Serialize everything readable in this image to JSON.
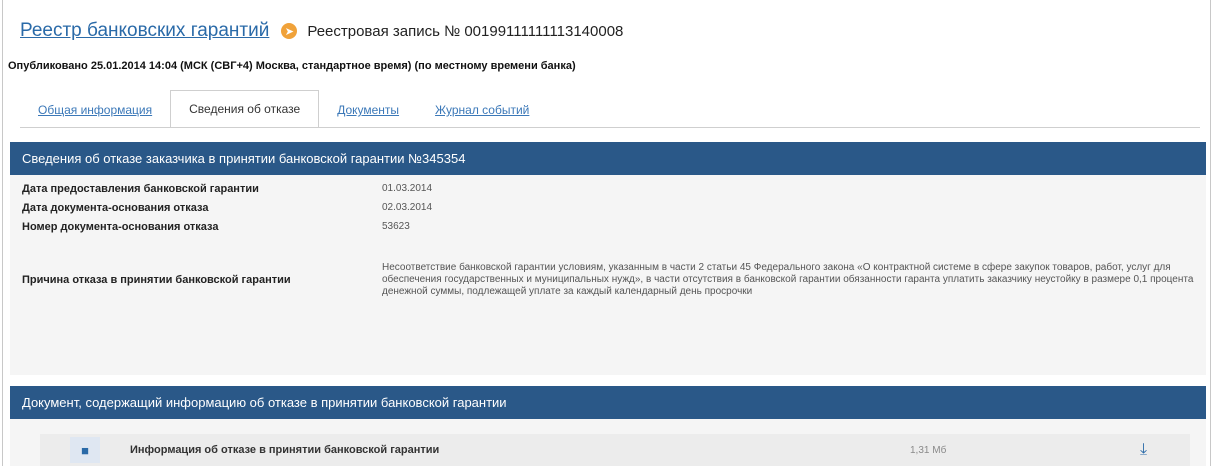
{
  "breadcrumb": {
    "root_label": "Реестр банковских гарантий",
    "current_label": "Реестровая запись № 00199111111113140008"
  },
  "published_text": "Опубликовано 25.01.2014 14:04 (МСК (СВГ+4) Москва, стандартное время) (по местному времени банка)",
  "tabs": [
    {
      "label": "Общая информация",
      "active": false
    },
    {
      "label": "Сведения об отказе",
      "active": true
    },
    {
      "label": "Документы",
      "active": false
    },
    {
      "label": "Журнал событий",
      "active": false
    }
  ],
  "refusal_section": {
    "title": "Сведения об отказе заказчика в принятии банковской гарантии №345354",
    "fields": [
      {
        "label": "Дата предоставления банковской гарантии",
        "value": "01.03.2014"
      },
      {
        "label": "Дата документа-основания отказа",
        "value": "02.03.2014"
      },
      {
        "label": "Номер документа-основания отказа",
        "value": "53623"
      },
      {
        "label": "Причина отказа в принятии банковской гарантии",
        "value": "Несоответствие банковской гарантии условиям, указанным в части 2 статьи 45 Федерального закона «О контрактной системе в сфере закупок товаров, работ, услуг для обеспечения государственных и муниципальных нужд», в части отсутствия в банковской гарантии обязанности гаранта уплатить заказчику неустойку в размере 0,1 процента денежной суммы, подлежащей уплате за каждый календарный день просрочки"
      }
    ]
  },
  "document_section": {
    "title": "Документ, содержащий информацию об отказе в принятии банковской гарантии",
    "document": {
      "icon": "document-icon",
      "title": "Информация об отказе в принятии банковской гарантии",
      "size": "1,31 Мб",
      "download_icon": "download-icon"
    }
  },
  "colors": {
    "link": "#2a6aa8",
    "panel_header": "#2a5888",
    "panel_bg": "#f5f5f5",
    "breadcrumb_arrow": "#f0a23a"
  }
}
